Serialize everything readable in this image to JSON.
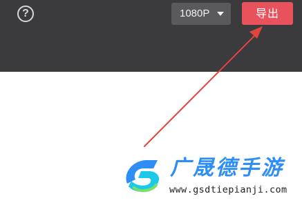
{
  "toolbar": {
    "help_label": "?",
    "resolution_label": "1080P",
    "export_label": "导出"
  },
  "icons": {
    "help": "question-circle-icon",
    "resolution_caret": "caret-down-icon",
    "annotation": "red-pointer-arrow"
  },
  "watermark": {
    "title": "广晟德手游",
    "url": "www.gsdtiepianji.com"
  },
  "colors": {
    "topbar_bg": "#3b3b3d",
    "resolution_bg": "#5a5a5c",
    "export_bg": "#e8525d",
    "arrow": "#e0443e",
    "watermark_blue": "#2f8ef5"
  }
}
